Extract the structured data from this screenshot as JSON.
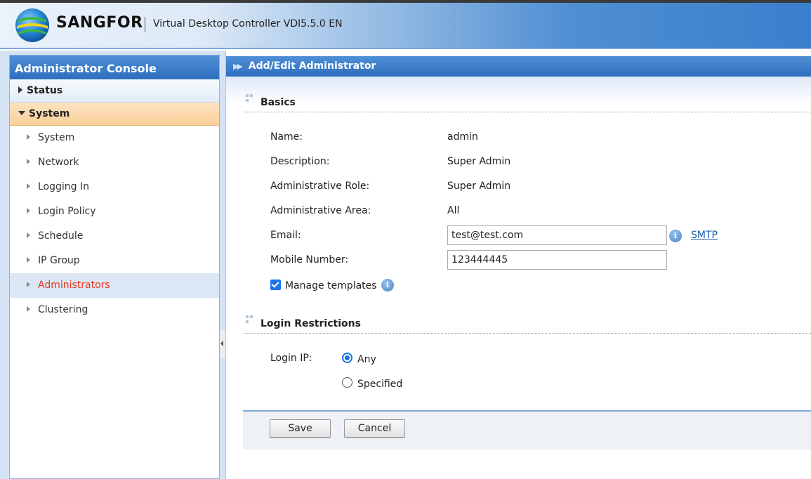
{
  "header": {
    "brand": "SANGFOR",
    "product": "Virtual Desktop Controller VDI5.5.0 EN"
  },
  "sidebar": {
    "title": "Administrator Console",
    "categories": [
      {
        "label": "Status",
        "expanded": false
      },
      {
        "label": "System",
        "expanded": true
      }
    ],
    "items": [
      {
        "label": "System"
      },
      {
        "label": "Network"
      },
      {
        "label": "Logging In"
      },
      {
        "label": "Login Policy"
      },
      {
        "label": "Schedule"
      },
      {
        "label": "IP Group"
      },
      {
        "label": "Administrators",
        "active": true
      },
      {
        "label": "Clustering"
      }
    ]
  },
  "main": {
    "title": "Add/Edit Administrator",
    "basics": {
      "heading": "Basics",
      "name_label": "Name:",
      "name_value": "admin",
      "description_label": "Description:",
      "description_value": "Super Admin",
      "role_label": "Administrative Role:",
      "role_value": "Super Admin",
      "area_label": "Administrative Area:",
      "area_value": "All",
      "email_label": "Email:",
      "email_value": "test@test.com",
      "smtp_link": "SMTP",
      "mobile_label": "Mobile Number:",
      "mobile_value": "123444445",
      "manage_templates_label": "Manage templates",
      "manage_templates_checked": true
    },
    "login_restrictions": {
      "heading": "Login Restrictions",
      "login_ip_label": "Login IP:",
      "options": [
        "Any",
        "Specified"
      ],
      "selected": "Any"
    },
    "buttons": {
      "save": "Save",
      "cancel": "Cancel"
    }
  },
  "colors": {
    "accent": "#2e6fbf",
    "active_item": "#e8371d",
    "link": "#1a5ea8",
    "checkbox": "#1a73e8"
  }
}
